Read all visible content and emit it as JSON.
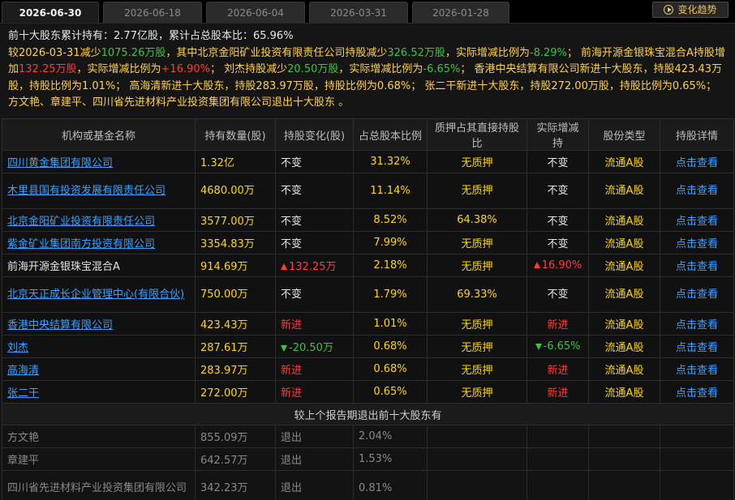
{
  "tabs": [
    {
      "label": "2026-06-30",
      "active": true
    },
    {
      "label": "2026-06-18",
      "active": false
    },
    {
      "label": "2026-06-04",
      "active": false
    },
    {
      "label": "2026-03-31",
      "active": false
    },
    {
      "label": "2026-01-28",
      "active": false
    }
  ],
  "trend_button": "变化趋势",
  "summary": {
    "line1_prefix": "前十大股东累计持有：",
    "line1_shares": "2.77亿股",
    "line1_mid": "，累计占总股本比：",
    "line1_pct": "65.96%",
    "p1": "较",
    "date": "2026-03-31",
    "p2": "减少",
    "total_decrease": "1075.26万股",
    "p3": "，其中北京金阳矿业投资有限责任公司持股减少",
    "a_dec": "326.52万股",
    "p4": "，实际增减比例为",
    "a_pct": "-8.29%",
    "p5": "； 前海开源金银珠宝混合A持股增加",
    "b_inc": "132.25万股",
    "p6": "，实际增减比例为",
    "b_pct": "+16.90%",
    "p7": "； 刘杰持股减少",
    "c_dec": "20.50万股",
    "p8": "，实际增减比例为",
    "c_pct": "-6.65%",
    "p9": "； 香港中央结算有限公司新进十大股东，持股423.43万股，持股比例为1.01%； 高海清新进十大股东，持股283.97万股，持股比例为0.68%； 张二干新进十大股东，持股272.00万股，持股比例为0.65%； 方文艳、章建平、四川省先进材料产业投资集团有限公司退出十大股东 。"
  },
  "table": {
    "headers": [
      "机构或基金名称",
      "持有数量(股)",
      "持股变化(股)",
      "占总股本比例",
      "质押占其直接持股比",
      "实际增减持",
      "股份类型",
      "持股详情"
    ],
    "rows": [
      {
        "name": "四川黄金集团有限公司",
        "link": true,
        "qty": "1.32亿",
        "change": "不变",
        "change_dir": "none",
        "pct": "31.32%",
        "pledge": "无质押",
        "actual": "不变",
        "actual_dir": "none",
        "type": "流通A股",
        "detail": "点击查看"
      },
      {
        "name": "木里县国有投资发展有限责任公司",
        "link": true,
        "qty": "4680.00万",
        "change": "不变",
        "change_dir": "none",
        "pct": "11.14%",
        "pledge": "无质押",
        "actual": "不变",
        "actual_dir": "none",
        "type": "流通A股",
        "detail": "点击查看"
      },
      {
        "name": "北京金阳矿业投资有限责任公司",
        "link": true,
        "qty": "3577.00万",
        "change": "不变",
        "change_dir": "none",
        "pct": "8.52%",
        "pledge": "64.38%",
        "actual": "不变",
        "actual_dir": "none",
        "type": "流通A股",
        "detail": "点击查看"
      },
      {
        "name": "紫金矿业集团南方投资有限公司",
        "link": true,
        "qty": "3354.83万",
        "change": "不变",
        "change_dir": "none",
        "pct": "7.99%",
        "pledge": "无质押",
        "actual": "不变",
        "actual_dir": "none",
        "type": "流通A股",
        "detail": "点击查看"
      },
      {
        "name": "前海开源金银珠宝混合A",
        "link": false,
        "qty": "914.69万",
        "change": "132.25万",
        "change_dir": "up",
        "pct": "2.18%",
        "pledge": "无质押",
        "actual": "16.90%",
        "actual_dir": "up",
        "type": "流通A股",
        "detail": "点击查看"
      },
      {
        "name": "北京天正成长企业管理中心(有限合伙)",
        "link": true,
        "qty": "750.00万",
        "change": "不变",
        "change_dir": "none",
        "pct": "1.79%",
        "pledge": "69.33%",
        "actual": "不变",
        "actual_dir": "none",
        "type": "流通A股",
        "detail": "点击查看"
      },
      {
        "name": "香港中央结算有限公司",
        "link": true,
        "qty": "423.43万",
        "change": "新进",
        "change_dir": "new",
        "pct": "1.01%",
        "pledge": "无质押",
        "actual": "新进",
        "actual_dir": "new",
        "type": "流通A股",
        "detail": "点击查看"
      },
      {
        "name": "刘杰",
        "link": true,
        "qty": "287.61万",
        "change": "-20.50万",
        "change_dir": "down",
        "pct": "0.68%",
        "pledge": "无质押",
        "actual": "-6.65%",
        "actual_dir": "down",
        "type": "流通A股",
        "detail": "点击查看"
      },
      {
        "name": "高海清",
        "link": true,
        "qty": "283.97万",
        "change": "新进",
        "change_dir": "new",
        "pct": "0.68%",
        "pledge": "无质押",
        "actual": "新进",
        "actual_dir": "new",
        "type": "流通A股",
        "detail": "点击查看"
      },
      {
        "name": "张二干",
        "link": true,
        "qty": "272.00万",
        "change": "新进",
        "change_dir": "new",
        "pct": "0.65%",
        "pledge": "无质押",
        "actual": "新进",
        "actual_dir": "new",
        "type": "流通A股",
        "detail": "点击查看"
      }
    ],
    "exit_title": "较上个报告期退出前十大股东有",
    "exit_rows": [
      {
        "name": "方文艳",
        "qty": "855.09万",
        "change": "退出",
        "pct": "2.04%"
      },
      {
        "name": "章建平",
        "qty": "642.57万",
        "change": "退出",
        "pct": "1.53%"
      },
      {
        "name": "四川省先进材料产业投资集团有限公司",
        "qty": "342.23万",
        "change": "退出",
        "pct": "0.81%"
      }
    ]
  },
  "colors": {
    "up": "#ff3b3b",
    "down": "#3fc43f",
    "link": "#3aa0ff",
    "qty": "#ffd700"
  }
}
